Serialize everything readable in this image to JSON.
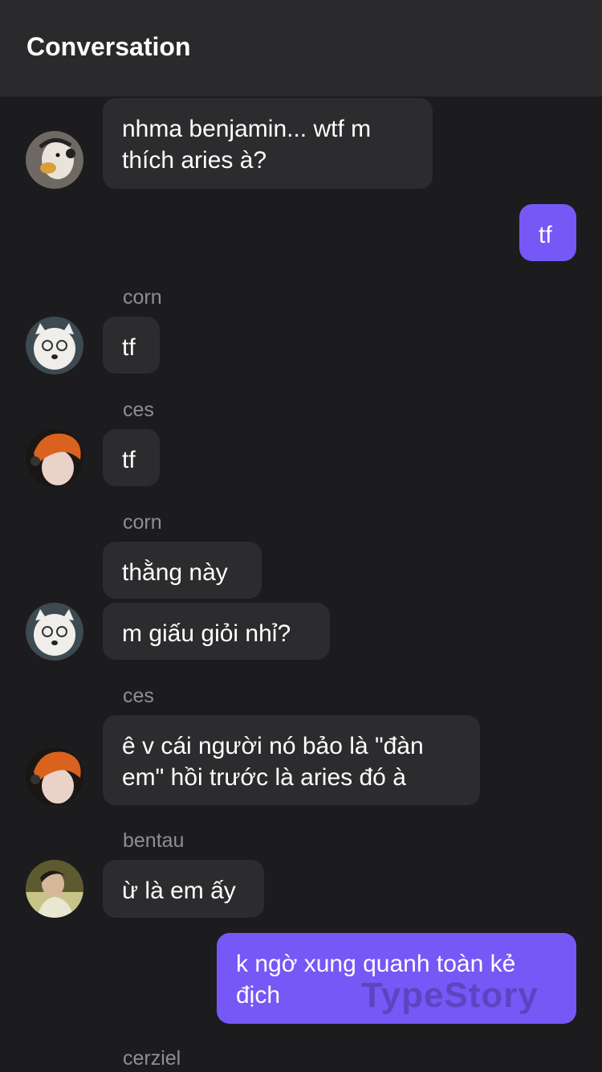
{
  "header": {
    "title": "Conversation"
  },
  "messages": [
    {
      "text": "nhma benjamin... wtf m thích aries à?"
    },
    {
      "text": "tf"
    },
    {
      "sender": "corn",
      "text": "tf"
    },
    {
      "sender": "ces",
      "text": "tf"
    },
    {
      "sender": "corn",
      "text": "thằng này"
    },
    {
      "text": "m giấu giỏi nhỉ?"
    },
    {
      "sender": "ces",
      "text": "ê v cái người nó bảo là \"đàn em\" hồi trước là aries đó à"
    },
    {
      "sender": "bentau",
      "text": "ừ là em ấy"
    },
    {
      "text": "k ngờ xung quanh toàn kẻ địch"
    },
    {
      "sender": "cerziel"
    }
  ],
  "watermark": "TypeStory",
  "colors": {
    "header": "#2a2a2c",
    "background": "#1c1c1e",
    "incoming_bubble": "#2c2c2e",
    "outgoing_bubble": "#7658f6",
    "sender_name": "#8e8e93"
  },
  "avatars": [
    "goose-avatar",
    "dog-avatar",
    "redhead-avatar",
    "dog-avatar",
    "redhead-avatar",
    "man-avatar"
  ]
}
